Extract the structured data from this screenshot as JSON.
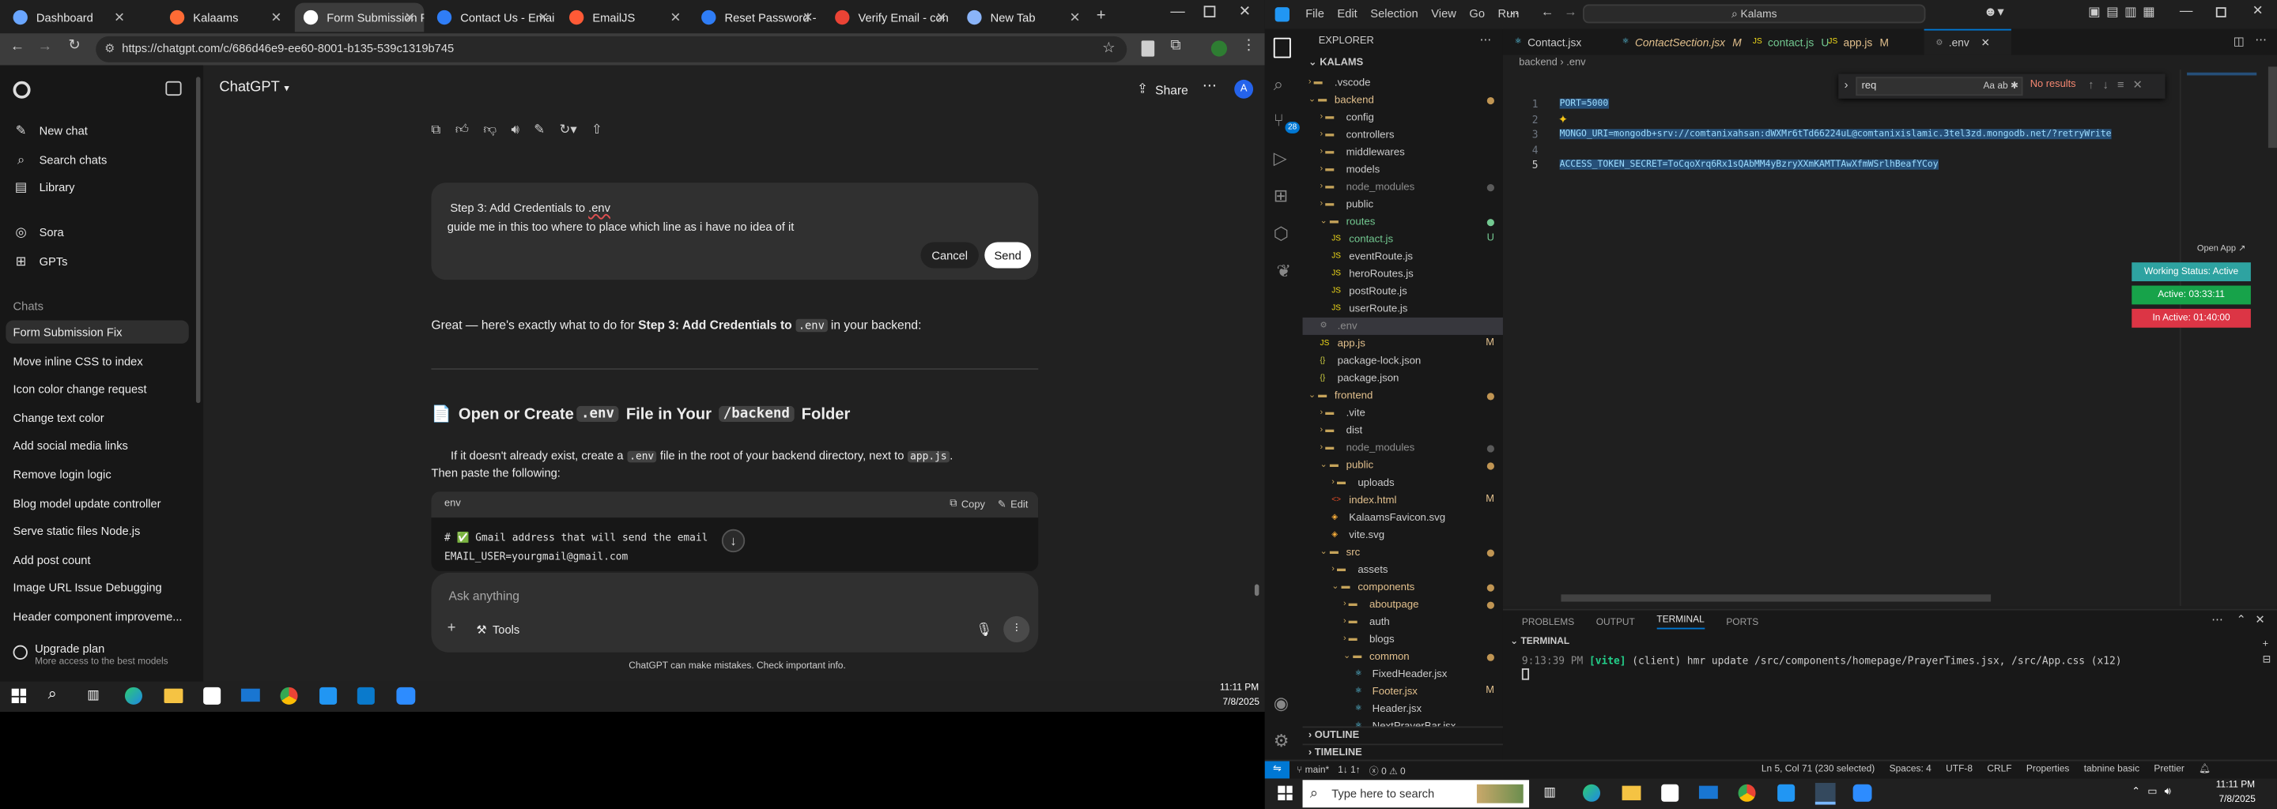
{
  "browser": {
    "tabs": [
      {
        "label": "Dashboard",
        "color": "#6aa6ff"
      },
      {
        "label": "Kalaams",
        "color": "#ff6b35"
      },
      {
        "label": "Form Submission Fix",
        "color": "#ffffff"
      },
      {
        "label": "Contact Us - Emai",
        "color": "#2f7df6"
      },
      {
        "label": "EmailJS",
        "color": "#ff5a36"
      },
      {
        "label": "Reset Password -",
        "color": "#2f7df6"
      },
      {
        "label": "Verify Email - con",
        "color": "#ea4335"
      },
      {
        "label": "New Tab",
        "color": "#8ab4f8"
      }
    ],
    "url": "https://chatgpt.com/c/686d46e9-ee60-8001-b135-539c1319b745"
  },
  "sidebar": {
    "top_items": [
      {
        "label": "New chat",
        "icon": "edit-icon"
      },
      {
        "label": "Search chats",
        "icon": "search-icon"
      },
      {
        "label": "Library",
        "icon": "library-icon"
      }
    ],
    "mid_items": [
      {
        "label": "Sora",
        "icon": "sora-icon"
      },
      {
        "label": "GPTs",
        "icon": "grid-icon"
      }
    ],
    "chats_heading": "Chats",
    "chats": [
      "Form Submission Fix",
      "Move inline CSS to index",
      "Icon color change request",
      "Change text color",
      "Add social media links",
      "Remove login logic",
      "Blog model update controller",
      "Serve static files Node.js",
      "Add post count",
      "Image URL Issue Debugging",
      "Header component improveme..."
    ],
    "upgrade_title": "Upgrade plan",
    "upgrade_sub": "More access to the best models"
  },
  "chat": {
    "model": "ChatGPT",
    "share": "Share",
    "avatar": "A",
    "edit_title_prefix": "Step 3: Add Credentials to ",
    "edit_title_code": ".env",
    "edit_body": "guide me in this too where to place which line as i have no idea of it",
    "cancel": "Cancel",
    "send": "Send",
    "answer_intro_pre": "Great — here's exactly what to do for ",
    "answer_intro_bold": "Step 3: Add Credentials to ",
    "answer_intro_code": ".env",
    "answer_intro_post": " in your backend:",
    "section_emoji": "📄",
    "section_pre": "Open or Create ",
    "section_code1": ".env",
    "section_mid": " File in Your ",
    "section_code2": "/backend",
    "section_post": " Folder",
    "p1_pre": "If it doesn't already exist, create a ",
    "p1_code1": ".env",
    "p1_mid": " file in the root of your backend directory, next to ",
    "p1_code2": "app.js",
    "p1_post": ".",
    "p2": "Then paste the following:",
    "code_lang": "env",
    "copy": "Copy",
    "edit": "Edit",
    "code_line1": "# ✅ Gmail address that will send the email",
    "code_line2": "EMAIL_USER=yourgmail@gmail.com",
    "input_placeholder": "Ask anything",
    "tools": "Tools",
    "disclaimer": "ChatGPT can make mistakes. Check important info."
  },
  "taskbar_left": {
    "time": "11:11 PM",
    "date": "7/8/2025"
  },
  "vscode": {
    "menu": [
      "File",
      "Edit",
      "Selection",
      "View",
      "Go",
      "Run"
    ],
    "search": "Kalams",
    "explorer_title": "EXPLORER",
    "root": "KALAMS",
    "tree": [
      {
        "label": ".vscode",
        "indent": 1,
        "type": "folder-closed",
        "color": "#cccccc"
      },
      {
        "label": "backend",
        "indent": 1,
        "type": "folder-open",
        "color": "#e2c08d",
        "dot": "#c09553"
      },
      {
        "label": "config",
        "indent": 2,
        "type": "folder-closed",
        "color": "#cccccc"
      },
      {
        "label": "controllers",
        "indent": 2,
        "type": "folder-closed",
        "color": "#cccccc"
      },
      {
        "label": "middlewares",
        "indent": 2,
        "type": "folder-closed",
        "color": "#cccccc"
      },
      {
        "label": "models",
        "indent": 2,
        "type": "folder-closed",
        "color": "#cccccc"
      },
      {
        "label": "node_modules",
        "indent": 2,
        "type": "folder-closed",
        "color": "#8c8c8c",
        "dot": "#5a5a5a"
      },
      {
        "label": "public",
        "indent": 2,
        "type": "folder-closed",
        "color": "#cccccc"
      },
      {
        "label": "routes",
        "indent": 2,
        "type": "folder-open",
        "color": "#73c991",
        "dot": "#73c991"
      },
      {
        "label": "contact.js",
        "indent": 3,
        "type": "js",
        "color": "#73c991",
        "badge": "U"
      },
      {
        "label": "eventRoute.js",
        "indent": 3,
        "type": "js",
        "color": "#cccccc"
      },
      {
        "label": "heroRoutes.js",
        "indent": 3,
        "type": "js",
        "color": "#cccccc"
      },
      {
        "label": "postRoute.js",
        "indent": 3,
        "type": "js",
        "color": "#cccccc"
      },
      {
        "label": "userRoute.js",
        "indent": 3,
        "type": "js",
        "color": "#cccccc"
      },
      {
        "label": ".env",
        "indent": 2,
        "type": "env",
        "color": "#8c8c8c",
        "selected": true
      },
      {
        "label": "app.js",
        "indent": 2,
        "type": "js",
        "color": "#e2c08d",
        "badge": "M"
      },
      {
        "label": "package-lock.json",
        "indent": 2,
        "type": "json",
        "color": "#cccccc"
      },
      {
        "label": "package.json",
        "indent": 2,
        "type": "json",
        "color": "#cccccc"
      },
      {
        "label": "frontend",
        "indent": 1,
        "type": "folder-open",
        "color": "#e2c08d",
        "dot": "#c09553"
      },
      {
        "label": ".vite",
        "indent": 2,
        "type": "folder-closed",
        "color": "#cccccc"
      },
      {
        "label": "dist",
        "indent": 2,
        "type": "folder-closed",
        "color": "#cccccc"
      },
      {
        "label": "node_modules",
        "indent": 2,
        "type": "folder-closed",
        "color": "#8c8c8c",
        "dot": "#5a5a5a"
      },
      {
        "label": "public",
        "indent": 2,
        "type": "folder-open",
        "color": "#e2c08d",
        "dot": "#c09553"
      },
      {
        "label": "uploads",
        "indent": 3,
        "type": "folder-closed",
        "color": "#cccccc"
      },
      {
        "label": "index.html",
        "indent": 3,
        "type": "html",
        "color": "#e2c08d",
        "badge": "M"
      },
      {
        "label": "KalaamsFavicon.svg",
        "indent": 3,
        "type": "svg",
        "color": "#cccccc"
      },
      {
        "label": "vite.svg",
        "indent": 3,
        "type": "svg",
        "color": "#cccccc"
      },
      {
        "label": "src",
        "indent": 2,
        "type": "folder-open",
        "color": "#e2c08d",
        "dot": "#c09553"
      },
      {
        "label": "assets",
        "indent": 3,
        "type": "folder-closed",
        "color": "#cccccc"
      },
      {
        "label": "components",
        "indent": 3,
        "type": "folder-open",
        "color": "#e2c08d",
        "dot": "#c09553"
      },
      {
        "label": "aboutpage",
        "indent": 4,
        "type": "folder-closed",
        "color": "#e2c08d",
        "dot": "#c09553"
      },
      {
        "label": "auth",
        "indent": 4,
        "type": "folder-closed",
        "color": "#cccccc"
      },
      {
        "label": "blogs",
        "indent": 4,
        "type": "folder-closed",
        "color": "#cccccc"
      },
      {
        "label": "common",
        "indent": 4,
        "type": "folder-open",
        "color": "#e2c08d",
        "dot": "#c09553"
      },
      {
        "label": "FixedHeader.jsx",
        "indent": 5,
        "type": "jsx",
        "color": "#cccccc"
      },
      {
        "label": "Footer.jsx",
        "indent": 5,
        "type": "jsx",
        "color": "#e2c08d",
        "badge": "M"
      },
      {
        "label": "Header.jsx",
        "indent": 5,
        "type": "jsx",
        "color": "#cccccc"
      },
      {
        "label": "NextPrayerBar.jsx",
        "indent": 5,
        "type": "jsx",
        "color": "#cccccc"
      }
    ],
    "outline": "OUTLINE",
    "timeline": "TIMELINE",
    "editor_tabs": [
      {
        "label": "Contact.jsx",
        "color": "#cccccc"
      },
      {
        "label": "ContactSection.jsx",
        "color": "#e2c08d",
        "italic": true,
        "badge": "M"
      },
      {
        "label": "contact.js",
        "color": "#73c991",
        "badge": "U"
      },
      {
        "label": "app.js",
        "color": "#e2c08d",
        "badge": "M"
      },
      {
        "label": ".env",
        "color": "#cccccc",
        "active": true
      }
    ],
    "breadcrumb": [
      "backend",
      ".env"
    ],
    "find_value": "req",
    "find_result": "No results",
    "lines": [
      {
        "num": "1",
        "text": "PORT=5000"
      },
      {
        "num": "2",
        "text": ""
      },
      {
        "num": "3",
        "text": "MONGO_URI=mongodb+srv://comtanixahsan:dWXMr6tTd66224uL@comtanixislamic.3tel3zd.mongodb.net/?retryWrite"
      },
      {
        "num": "4",
        "text": ""
      },
      {
        "num": "5",
        "text": "ACCESS_TOKEN_SECRET=ToCqoXrq6Rx1sQAbMM4yBzryXXmKAMTTAwXfmWSrlhBeafYCoy"
      }
    ],
    "open_app": "Open App ↗",
    "status_widgets": [
      {
        "label": "Working Status: Active",
        "bg": "#2ea3a1"
      },
      {
        "label": "Active: 03:33:11",
        "bg": "#17a34a"
      },
      {
        "label": "In Active: 01:40:00",
        "bg": "#dc3545"
      }
    ],
    "panel_tabs": [
      "PROBLEMS",
      "OUTPUT",
      "TERMINAL",
      "PORTS"
    ],
    "terminal_header": "TERMINAL",
    "terminal_time": "9:13:39 PM",
    "terminal_vite": "[vite]",
    "terminal_msg": "(client) hmr update /src/components/homepage/PrayerTimes.jsx, /src/App.css (x12)",
    "status": {
      "branch": "main*",
      "sync": "1↓ 1↑",
      "problems": "0 ⚠ 0",
      "position": "Ln 5, Col 71 (230 selected)",
      "spaces": "Spaces: 4",
      "encoding": "UTF-8",
      "eol": "CRLF",
      "properties": "Properties",
      "tabnine": "tabnine basic",
      "prettier": "Prettier"
    }
  },
  "taskbar_right": {
    "search": "Type here to search",
    "time": "11:11 PM",
    "date": "7/8/2025"
  }
}
